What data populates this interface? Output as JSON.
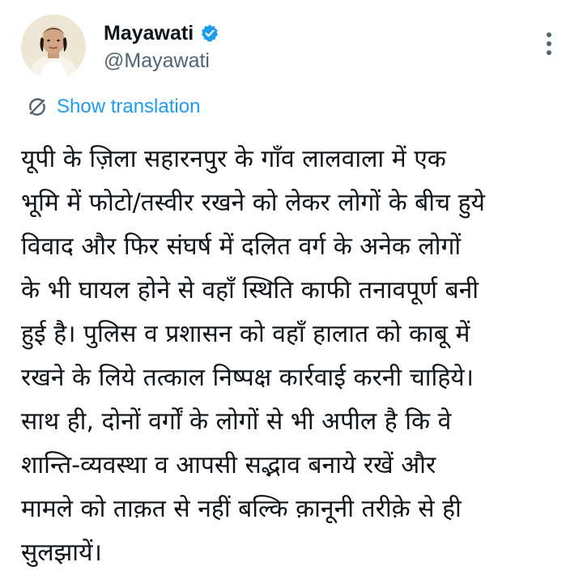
{
  "author": {
    "display_name": "Mayawati",
    "handle": "@Mayawati",
    "avatar_icon": "profile-photo",
    "verified_icon": "verified-badge-icon",
    "verified_color": "#1d9bf0"
  },
  "more_icon": "more-options-icon",
  "translation": {
    "label": "Show translation",
    "icon": "translate-icon",
    "color": "#1d9bf0"
  },
  "tweet": {
    "lines": [
      "यूपी के ज़िला सहारनपुर के गाँव लालवाला में एक",
      "भूमि में फोटो/तस्वीर रखने को लेकर लोगों के बीच हुये",
      "विवाद और फिर संघर्ष में दलित वर्ग के अनेक लोगों",
      "के भी घायल होने से वहाँ स्थिति काफी तनावपूर्ण बनी",
      "हुई है। पुलिस व प्रशासन को वहाँ हालात को काबू में",
      "रखने के लिये तत्काल निष्पक्ष कार्रवाई करनी चाहिये।",
      "साथ ही, दोनों वर्गों के लोगों से भी अपील है कि वे",
      "शान्ति-व्यवस्था व आपसी सद्भाव बनाये रखें और",
      "मामले को ताक़त से नहीं बल्कि क़ानूनी तरीक़े से ही",
      "सुलझायें।"
    ]
  }
}
